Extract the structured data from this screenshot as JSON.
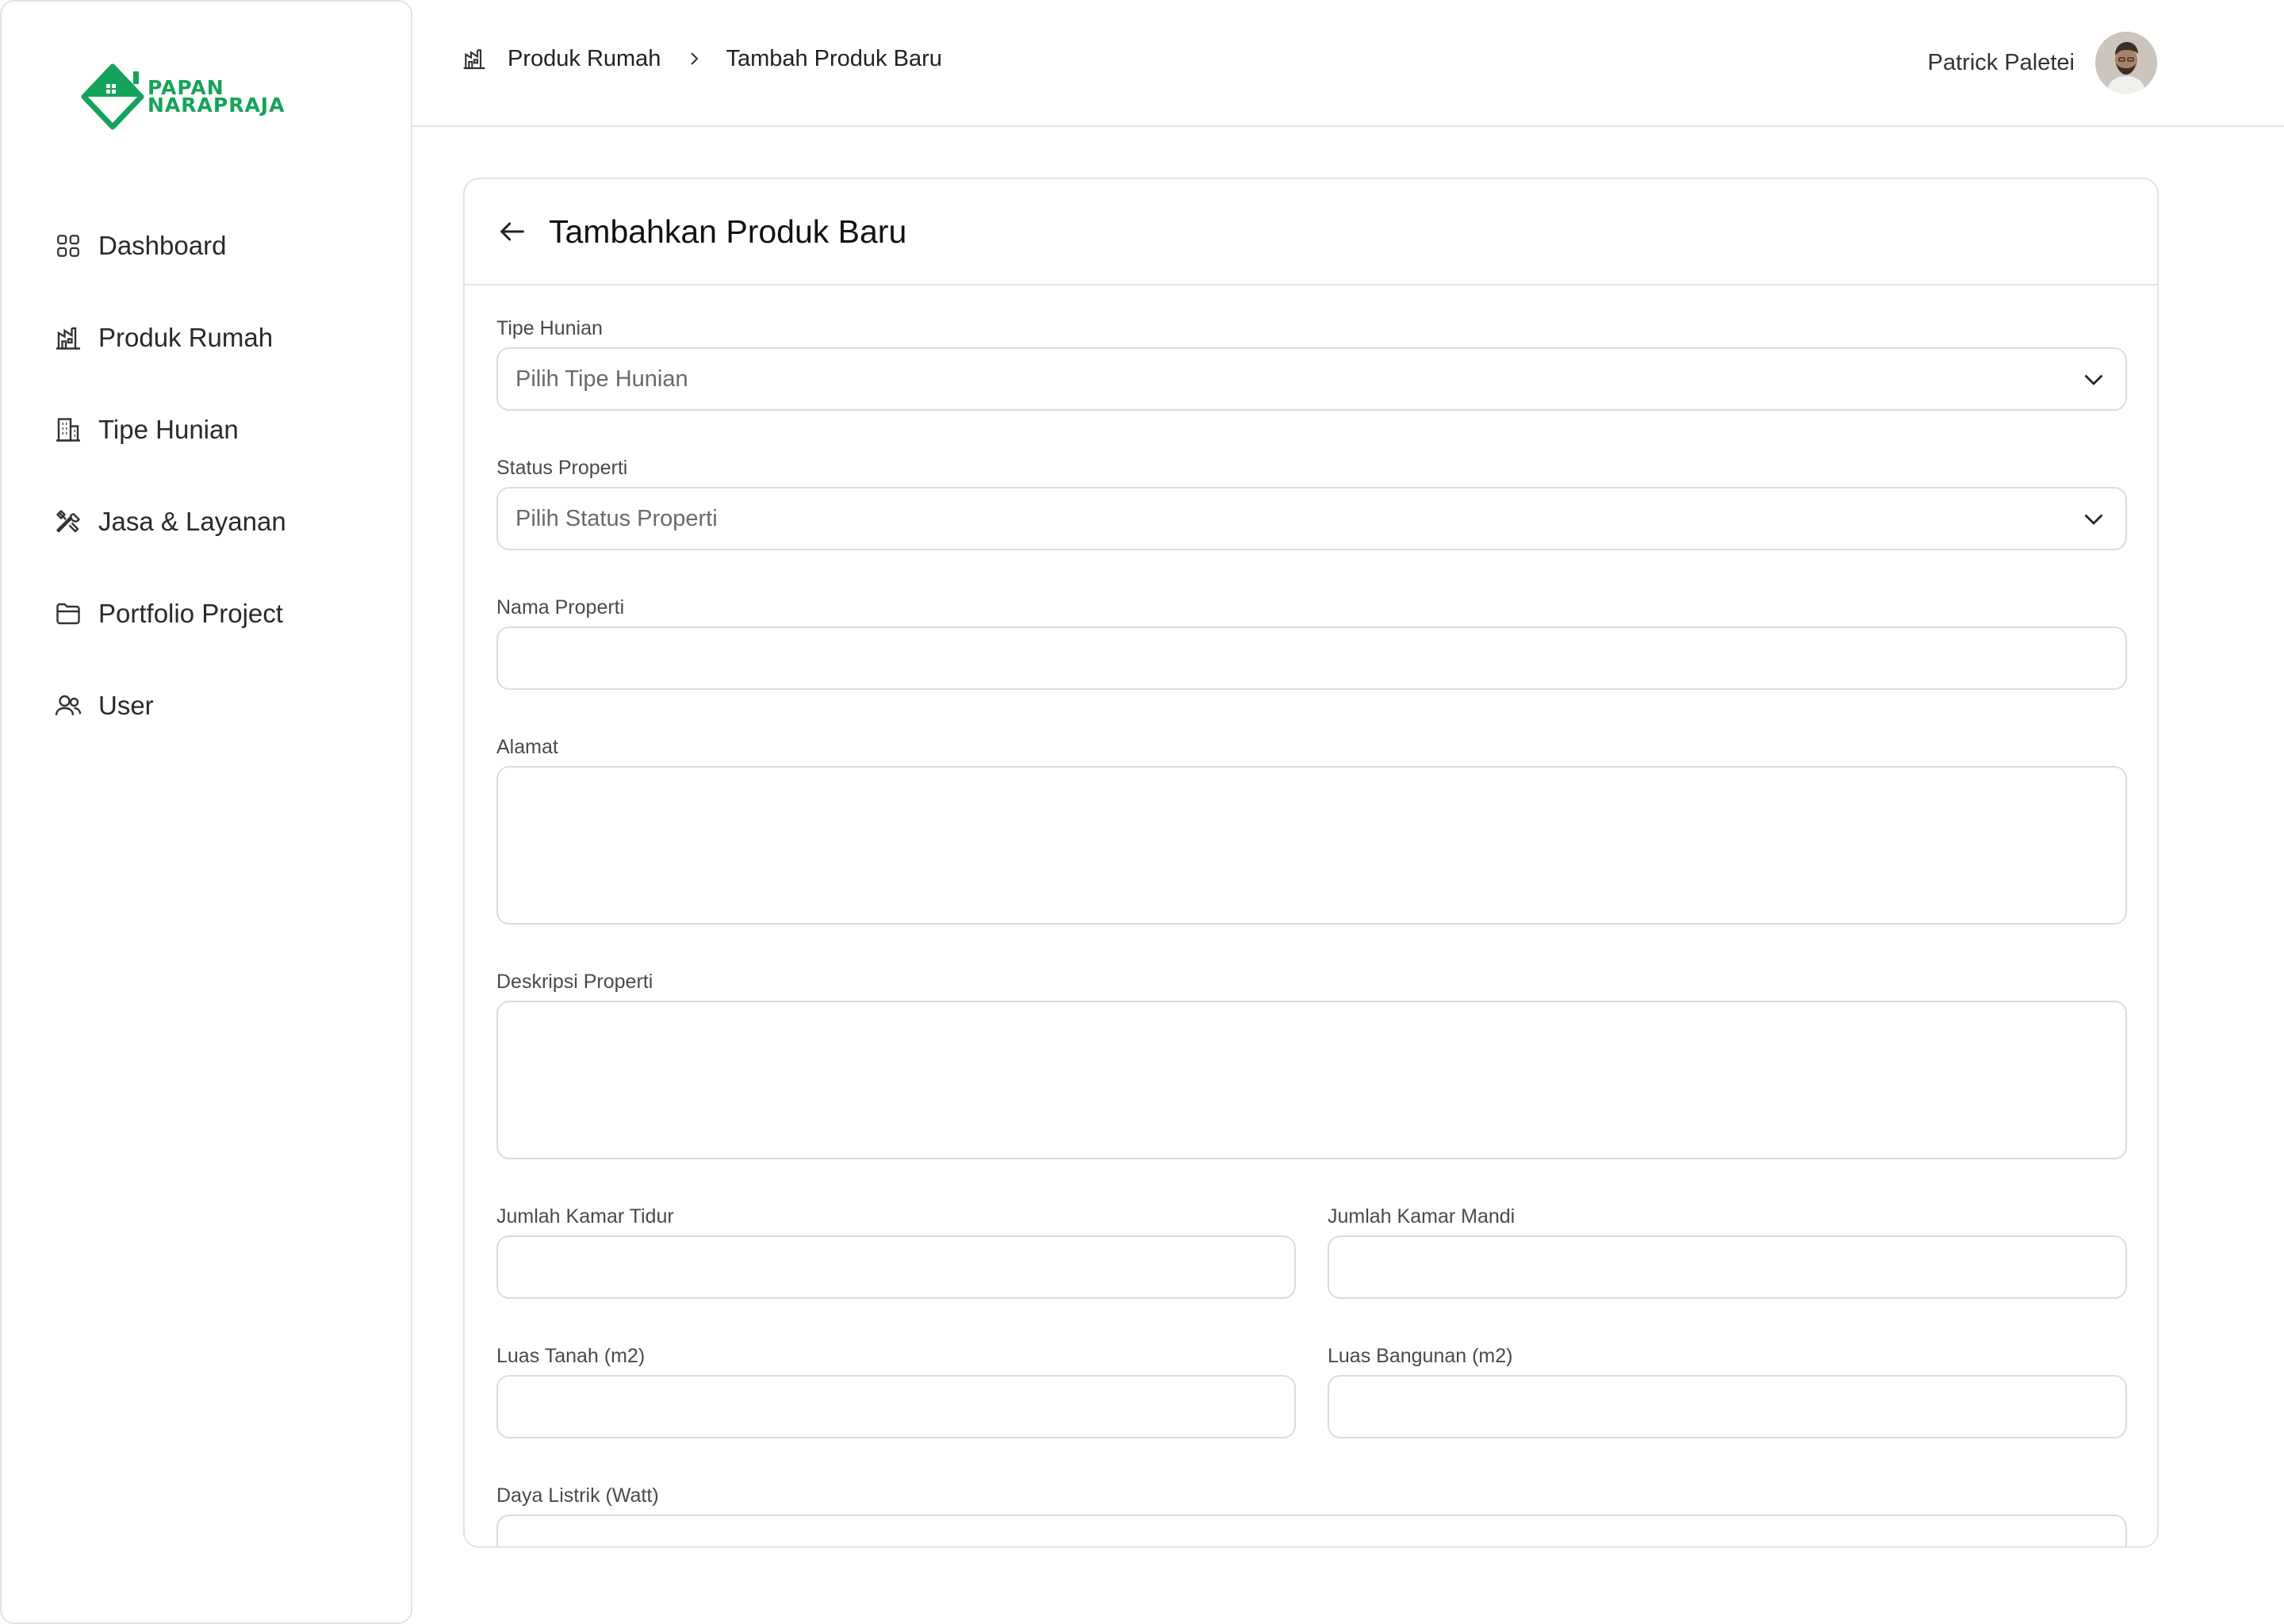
{
  "brand": {
    "line1": "PAPAN",
    "line2": "NARAPRAJA",
    "color": "#14a35a"
  },
  "sidebar": {
    "items": [
      {
        "label": "Dashboard",
        "icon": "grid-icon"
      },
      {
        "label": "Produk Rumah",
        "icon": "house-chart-icon"
      },
      {
        "label": "Tipe Hunian",
        "icon": "building-icon"
      },
      {
        "label": "Jasa & Layanan",
        "icon": "tools-icon"
      },
      {
        "label": "Portfolio Project",
        "icon": "folder-icon"
      },
      {
        "label": "User",
        "icon": "users-icon"
      }
    ]
  },
  "header": {
    "breadcrumb": {
      "parent": "Produk Rumah",
      "current": "Tambah Produk Baru"
    },
    "user_name": "Patrick Paletei"
  },
  "form": {
    "title": "Tambahkan Produk Baru",
    "tipe_hunian": {
      "label": "Tipe Hunian",
      "placeholder": "Pilih Tipe Hunian"
    },
    "status_properti": {
      "label": "Status Properti",
      "placeholder": "Pilih Status Properti"
    },
    "nama_properti": {
      "label": "Nama Properti",
      "value": ""
    },
    "alamat": {
      "label": "Alamat",
      "value": ""
    },
    "deskripsi": {
      "label": "Deskripsi Properti",
      "value": ""
    },
    "kamar_tidur": {
      "label": "Jumlah Kamar Tidur",
      "value": ""
    },
    "kamar_mandi": {
      "label": "Jumlah Kamar Mandi",
      "value": ""
    },
    "luas_tanah": {
      "label": "Luas Tanah (m2)",
      "value": ""
    },
    "luas_bangunan": {
      "label": "Luas Bangunan (m2)",
      "value": ""
    },
    "daya_listrik": {
      "label": "Daya Listrik (Watt)",
      "value": ""
    }
  }
}
